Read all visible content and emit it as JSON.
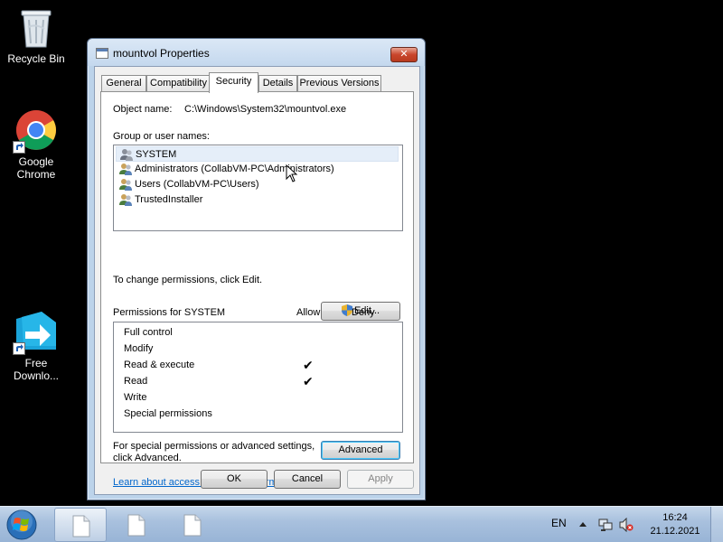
{
  "desktop": {
    "icons": [
      {
        "label": "Recycle Bin"
      },
      {
        "label": "Google Chrome"
      },
      {
        "label": "Free Downlo..."
      }
    ]
  },
  "window": {
    "title": "mountvol Properties",
    "close_label": "✕",
    "tabs": [
      {
        "label": "General"
      },
      {
        "label": "Compatibility"
      },
      {
        "label": "Security"
      },
      {
        "label": "Details"
      },
      {
        "label": "Previous Versions"
      }
    ],
    "active_tab": "Security",
    "object_name_label": "Object name:",
    "object_name_value": "C:\\Windows\\System32\\mountvol.exe",
    "groups_label": "Group or user names:",
    "groups": [
      {
        "name": "SYSTEM",
        "selected": true
      },
      {
        "name": "Administrators (CollabVM-PC\\Administrators)",
        "selected": false
      },
      {
        "name": "Users (CollabVM-PC\\Users)",
        "selected": false
      },
      {
        "name": "TrustedInstaller",
        "selected": false
      }
    ],
    "change_permissions_text": "To change permissions, click Edit.",
    "edit_button": "Edit...",
    "permissions_label": "Permissions for SYSTEM",
    "allow_header": "Allow",
    "deny_header": "Deny",
    "permissions": [
      {
        "name": "Full control",
        "allow": false,
        "deny": false
      },
      {
        "name": "Modify",
        "allow": false,
        "deny": false
      },
      {
        "name": "Read & execute",
        "allow": true,
        "deny": false
      },
      {
        "name": "Read",
        "allow": true,
        "deny": false
      },
      {
        "name": "Write",
        "allow": false,
        "deny": false
      },
      {
        "name": "Special permissions",
        "allow": false,
        "deny": false
      }
    ],
    "check_glyph": "✔",
    "advanced_text_line1": "For special permissions or advanced settings,",
    "advanced_text_line2": "click Advanced.",
    "advanced_button": "Advanced",
    "learn_link": "Learn about access control and permissions",
    "ok_button": "OK",
    "cancel_button": "Cancel",
    "apply_button": "Apply"
  },
  "taskbar": {
    "language": "EN",
    "time": "16:24",
    "date": "21.12.2021"
  },
  "colors": {
    "desktop_bg": "#000000",
    "link": "#0066cc",
    "selected_row": "#e5eef9"
  }
}
